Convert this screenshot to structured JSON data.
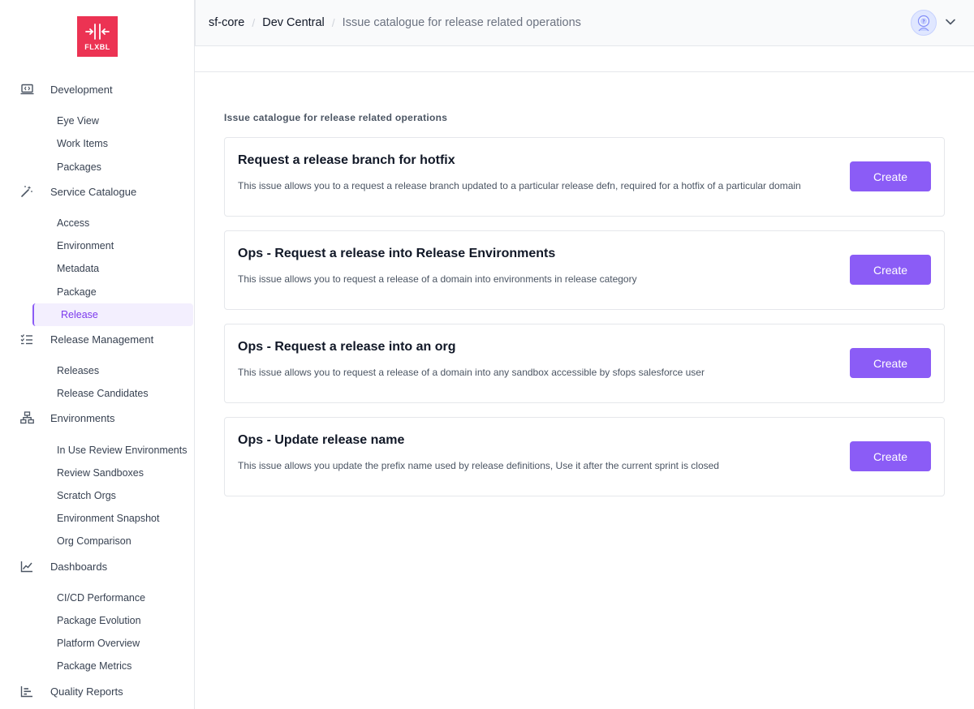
{
  "brand": {
    "logo_text": "FLXBL",
    "logo_color": "#ec3353",
    "accent": "#8b5cf6"
  },
  "breadcrumb": [
    "sf-core",
    "Dev Central",
    "Issue catalogue for release related operations"
  ],
  "sidebar": {
    "sections": [
      {
        "label": "Development",
        "icon": "laptop-code-icon",
        "items": [
          "Eye View",
          "Work Items",
          "Packages"
        ]
      },
      {
        "label": "Service Catalogue",
        "icon": "magic-wand-icon",
        "items": [
          "Access",
          "Environment",
          "Metadata",
          "Package",
          "Release"
        ]
      },
      {
        "label": "Release Management",
        "icon": "checklist-icon",
        "items": [
          "Releases",
          "Release Candidates"
        ]
      },
      {
        "label": "Environments",
        "icon": "network-icon",
        "items": [
          "In Use Review Environments",
          "Review Sandboxes",
          "Scratch Orgs",
          "Environment Snapshot",
          "Org Comparison"
        ]
      },
      {
        "label": "Dashboards",
        "icon": "line-chart-icon",
        "items": [
          "CI/CD Performance",
          "Package Evolution",
          "Platform Overview",
          "Package Metrics"
        ]
      },
      {
        "label": "Quality Reports",
        "icon": "bar-chart-icon",
        "items": []
      }
    ],
    "active_item": "Release"
  },
  "main": {
    "heading": "Issue catalogue for release related operations",
    "cards": [
      {
        "title": "Request a release branch for hotfix",
        "description": "This issue allows you to a request a release branch updated to a particular release defn, required for a hotfix of a particular domain",
        "button": "Create"
      },
      {
        "title": "Ops - Request a release into Release Environments",
        "description": "This issue allows you to request a release of a domain into environments in release category",
        "button": "Create"
      },
      {
        "title": "Ops - Request a release into an org",
        "description": "This issue allows you to request a release of a domain into any sandbox accessible by sfops salesforce user",
        "button": "Create"
      },
      {
        "title": "Ops - Update release name",
        "description": "This issue allows you update the prefix name used by release definitions, Use it after the current sprint is closed",
        "button": "Create"
      }
    ]
  }
}
